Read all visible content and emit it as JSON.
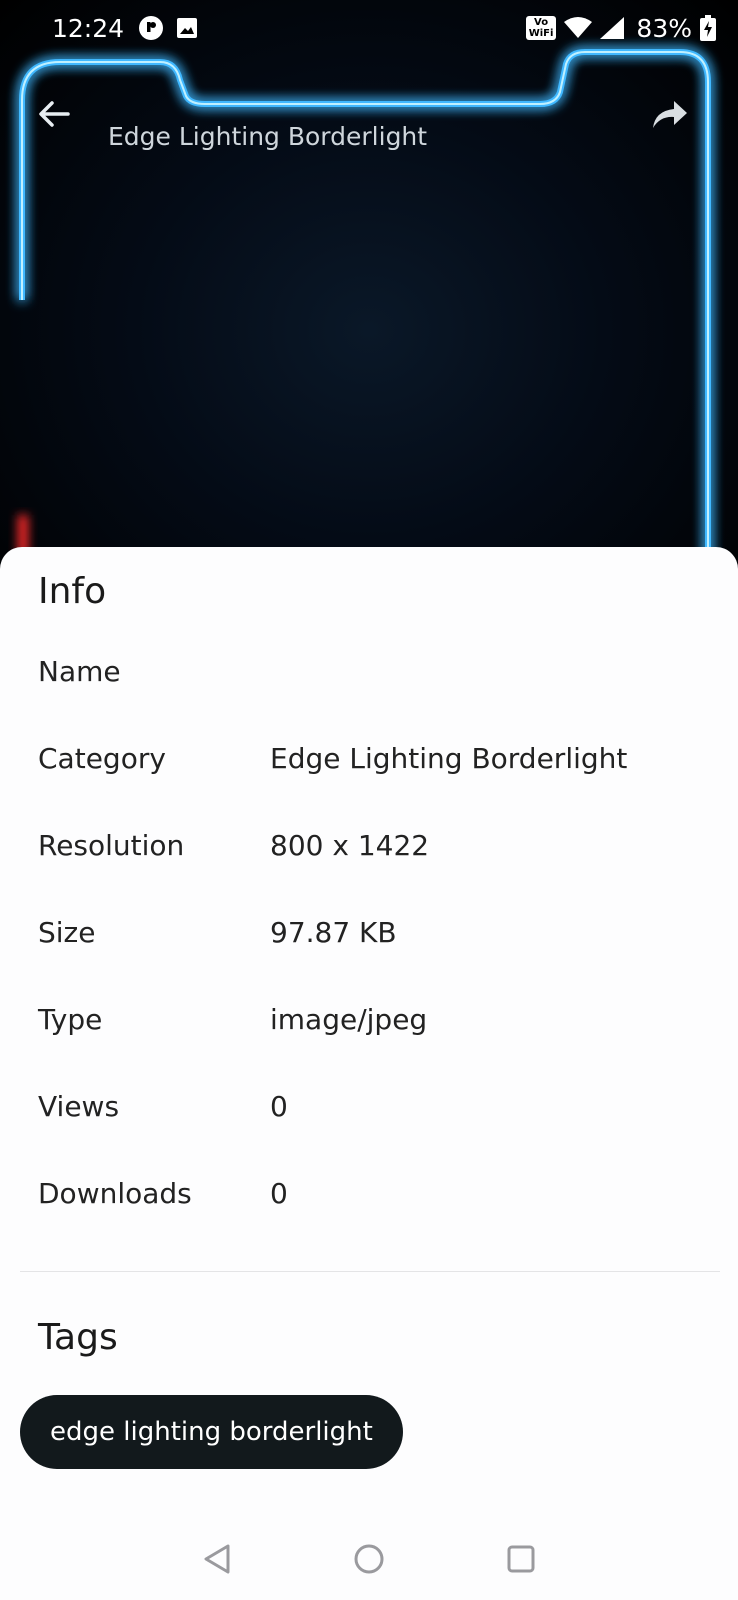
{
  "status_bar": {
    "time": "12:24",
    "battery": "83%",
    "vowifi_top": "Vo",
    "vowifi_bottom": "WiFi"
  },
  "app_bar": {
    "title": "Edge Lighting Borderlight",
    "back_icon": "arrow-left-icon",
    "share_icon": "share-icon"
  },
  "info": {
    "heading": "Info",
    "rows": [
      {
        "label": "Name",
        "value": ""
      },
      {
        "label": "Category",
        "value": "Edge Lighting Borderlight"
      },
      {
        "label": "Resolution",
        "value": "800 x 1422"
      },
      {
        "label": "Size",
        "value": "97.87 KB"
      },
      {
        "label": "Type",
        "value": "image/jpeg"
      },
      {
        "label": "Views",
        "value": "0"
      },
      {
        "label": "Downloads",
        "value": "0"
      }
    ]
  },
  "tags": {
    "heading": "Tags",
    "items": [
      "edge lighting borderlight"
    ]
  },
  "colors": {
    "glow": "#3fb8ff",
    "chip_bg": "#12191c",
    "sheet_bg": "#fdfdfe"
  }
}
